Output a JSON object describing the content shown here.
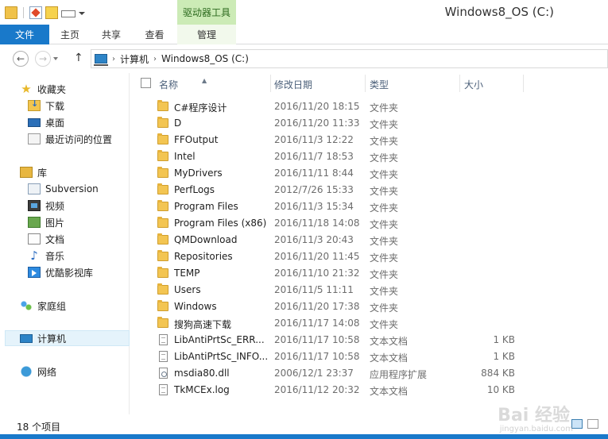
{
  "window": {
    "title": "Windows8_OS (C:)",
    "context_tab_group": "驱动器工具"
  },
  "ribbon": {
    "tabs": [
      {
        "label": "文件",
        "active": true
      },
      {
        "label": "主页"
      },
      {
        "label": "共享"
      },
      {
        "label": "查看"
      },
      {
        "label": "管理"
      }
    ]
  },
  "address": {
    "crumbs": [
      "计算机",
      "Windows8_OS (C:)"
    ]
  },
  "navpane": {
    "favorites": {
      "label": "收藏夹",
      "items": [
        "下载",
        "桌面",
        "最近访问的位置"
      ]
    },
    "libraries": {
      "label": "库",
      "items": [
        "Subversion",
        "视频",
        "图片",
        "文档",
        "音乐",
        "优酷影视库"
      ]
    },
    "homegroup": "家庭组",
    "computer": "计算机",
    "network": "网络"
  },
  "columns": {
    "name": "名称",
    "date": "修改日期",
    "type": "类型",
    "size": "大小"
  },
  "files": [
    {
      "name": "C#程序设计",
      "date": "2016/11/20 18:15",
      "type": "文件夹",
      "size": "",
      "icon": "folder"
    },
    {
      "name": "D",
      "date": "2016/11/20 11:33",
      "type": "文件夹",
      "size": "",
      "icon": "folder"
    },
    {
      "name": "FFOutput",
      "date": "2016/11/3 12:22",
      "type": "文件夹",
      "size": "",
      "icon": "folder"
    },
    {
      "name": "Intel",
      "date": "2016/11/7 18:53",
      "type": "文件夹",
      "size": "",
      "icon": "folder"
    },
    {
      "name": "MyDrivers",
      "date": "2016/11/11 8:44",
      "type": "文件夹",
      "size": "",
      "icon": "folder"
    },
    {
      "name": "PerfLogs",
      "date": "2012/7/26 15:33",
      "type": "文件夹",
      "size": "",
      "icon": "folder"
    },
    {
      "name": "Program Files",
      "date": "2016/11/3 15:34",
      "type": "文件夹",
      "size": "",
      "icon": "folder"
    },
    {
      "name": "Program Files (x86)",
      "date": "2016/11/18 14:08",
      "type": "文件夹",
      "size": "",
      "icon": "folder"
    },
    {
      "name": "QMDownload",
      "date": "2016/11/3 20:43",
      "type": "文件夹",
      "size": "",
      "icon": "folder"
    },
    {
      "name": "Repositories",
      "date": "2016/11/20 11:45",
      "type": "文件夹",
      "size": "",
      "icon": "folder"
    },
    {
      "name": "TEMP",
      "date": "2016/11/10 21:32",
      "type": "文件夹",
      "size": "",
      "icon": "folder"
    },
    {
      "name": "Users",
      "date": "2016/11/5 11:11",
      "type": "文件夹",
      "size": "",
      "icon": "folder"
    },
    {
      "name": "Windows",
      "date": "2016/11/20 17:38",
      "type": "文件夹",
      "size": "",
      "icon": "folder"
    },
    {
      "name": "搜狗高速下载",
      "date": "2016/11/17 14:08",
      "type": "文件夹",
      "size": "",
      "icon": "folder"
    },
    {
      "name": "LibAntiPrtSc_ERR...",
      "date": "2016/11/17 10:58",
      "type": "文本文档",
      "size": "1 KB",
      "icon": "txt"
    },
    {
      "name": "LibAntiPrtSc_INFO...",
      "date": "2016/11/17 10:58",
      "type": "文本文档",
      "size": "1 KB",
      "icon": "txt"
    },
    {
      "name": "msdia80.dll",
      "date": "2006/12/1 23:37",
      "type": "应用程序扩展",
      "size": "884 KB",
      "icon": "dll"
    },
    {
      "name": "TkMCEx.log",
      "date": "2016/11/12 20:32",
      "type": "文本文档",
      "size": "10 KB",
      "icon": "txt"
    }
  ],
  "status": {
    "item_count": "18 个项目"
  },
  "watermark": {
    "text": "Bai 经验",
    "url": "jingyan.baidu.com"
  }
}
